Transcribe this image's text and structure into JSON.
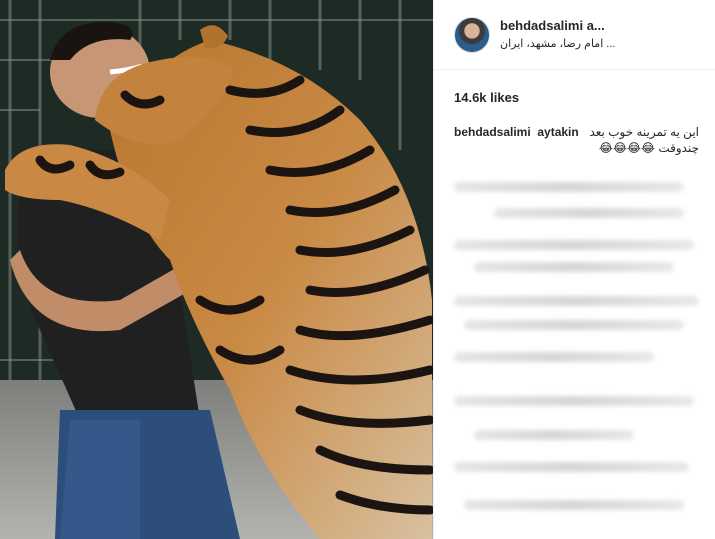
{
  "post": {
    "username": "behdadsalimi",
    "username_header": "behdadsalimi  a...",
    "location": "... امام رضا، مشهد، ایران",
    "likes": "14.6k likes"
  },
  "comment": {
    "user": "behdadsalimi",
    "mention": "aytakin",
    "text_line1": "این یه تمرینه خوب بعد",
    "text_line2": "چندوقت 😂😂😂😂"
  },
  "colors": {
    "text": "#262626",
    "divider": "#efefef",
    "blurred_text": "#d6d6d6"
  },
  "icons": {
    "avatar": "profile-photo"
  }
}
